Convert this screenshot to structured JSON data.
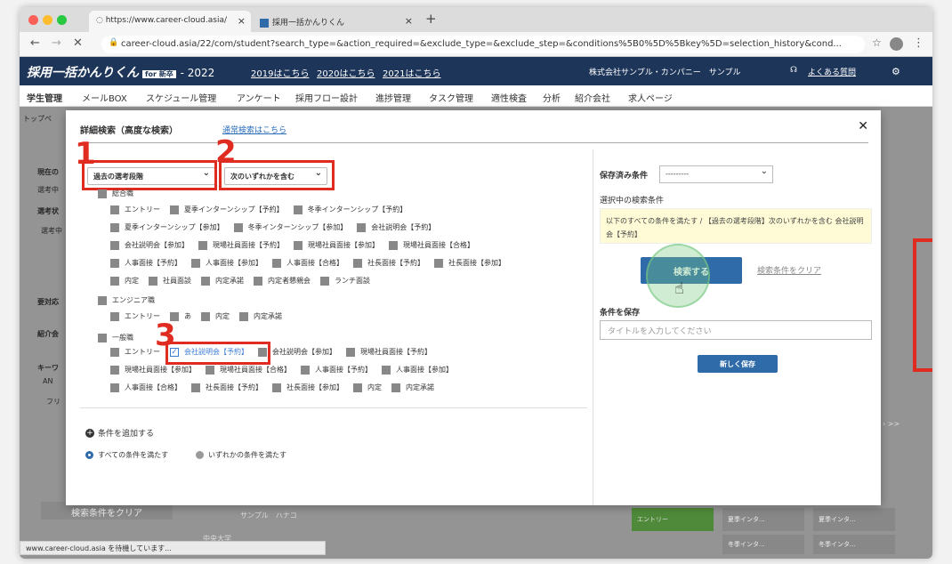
{
  "browser": {
    "tab_active": "https://www.career-cloud.asia/",
    "tab_other": "採用一括かんりくん",
    "url": "career-cloud.asia/22/com/student?search_type=&action_required=&exclude_type=&exclude_step=&conditions%5B0%5D%5Bkey%5D=selection_history&cond..."
  },
  "header": {
    "logo": "採用一括かんりくん",
    "logo_badge": "for 新卒",
    "year": "- 2022",
    "links": [
      "2019はこちら",
      "2020はこちら",
      "2021はこちら"
    ],
    "company": "株式会社サンプル・カンパニー　サンプル",
    "faq": "よくある質問"
  },
  "menu": [
    "学生管理",
    "メールBOX",
    "スケジュール管理",
    "アンケート",
    "採用フロー設計",
    "進捗管理",
    "タスク管理",
    "適性検査",
    "分析",
    "紹介会社",
    "求人ページ"
  ],
  "background": {
    "breadcrumb": "トップペ",
    "labels": [
      "現在の",
      "選考中",
      "選考状",
      "選考中",
      "要対応",
      "紹介会",
      "キーワ",
      "AN",
      "フリ"
    ],
    "clear_button": "検索条件をクリア",
    "candidate": "サンプル　ハナコ",
    "university": "中央大学",
    "status": "www.career-cloud.asia を待機しています...",
    "chips": [
      "エントリー",
      "夏季インタ...",
      "夏季インタ...",
      "冬季インタ...",
      "冬季インタ..."
    ],
    "pager": "›  >>"
  },
  "modal": {
    "title": "詳細検索（高度な検索）",
    "switch_link": "通常検索はこちら",
    "close": "✕",
    "select1": "過去の選考段階",
    "select2": "次のいずれかを含む",
    "annotations": [
      "1",
      "2",
      "3"
    ],
    "group_sougou": "総合職",
    "sougou_rows": [
      [
        "エントリー",
        "夏季インターンシップ【予約】",
        "冬季インターンシップ【予約】"
      ],
      [
        "夏季インターンシップ【参加】",
        "冬季インターンシップ【参加】",
        "会社説明会【予約】"
      ],
      [
        "会社説明会【参加】",
        "現場社員面接【予約】",
        "現場社員面接【参加】",
        "現場社員面接【合格】"
      ],
      [
        "人事面接【予約】",
        "人事面接【参加】",
        "人事面接【合格】",
        "社長面接【予約】",
        "社長面接【参加】"
      ],
      [
        "内定",
        "社員面談",
        "内定承諾",
        "内定者懇親会",
        "ランチ面談"
      ]
    ],
    "group_engineer": "エンジニア職",
    "engineer_row": [
      "エントリー",
      "あ",
      "内定",
      "内定承諾"
    ],
    "group_ippan": "一般職",
    "ippan_row1": [
      "エントリー",
      "会社説明会【予約】",
      "会社説明会【参加】",
      "現場社員面接【予約】"
    ],
    "ippan_row2": [
      "現場社員面接【参加】",
      "現場社員面接【合格】",
      "人事面接【予約】",
      "人事面接【参加】"
    ],
    "ippan_row3": [
      "人事面接【合格】",
      "社長面接【予約】",
      "社長面接【参加】",
      "内定",
      "内定承諾"
    ],
    "add_condition": "条件を追加する",
    "radio_all": "すべての条件を満たす",
    "radio_any": "いずれかの条件を満たす",
    "saved_label": "保存済み条件",
    "saved_value": "---------",
    "selected_label": "選択中の検索条件",
    "condition_text": "以下のすべての条件を満たす / 【過去の選考段階】次のいずれかを含む 会社説明会【予約】",
    "search_button": "検索する",
    "clear_link": "検索条件をクリア",
    "save_label": "条件を保存",
    "title_placeholder": "タイトルを入力してください",
    "new_save": "新しく保存"
  },
  "colors": {
    "header": "#1d3559",
    "accent": "#2f6ba8",
    "annotation": "#e02b20"
  }
}
